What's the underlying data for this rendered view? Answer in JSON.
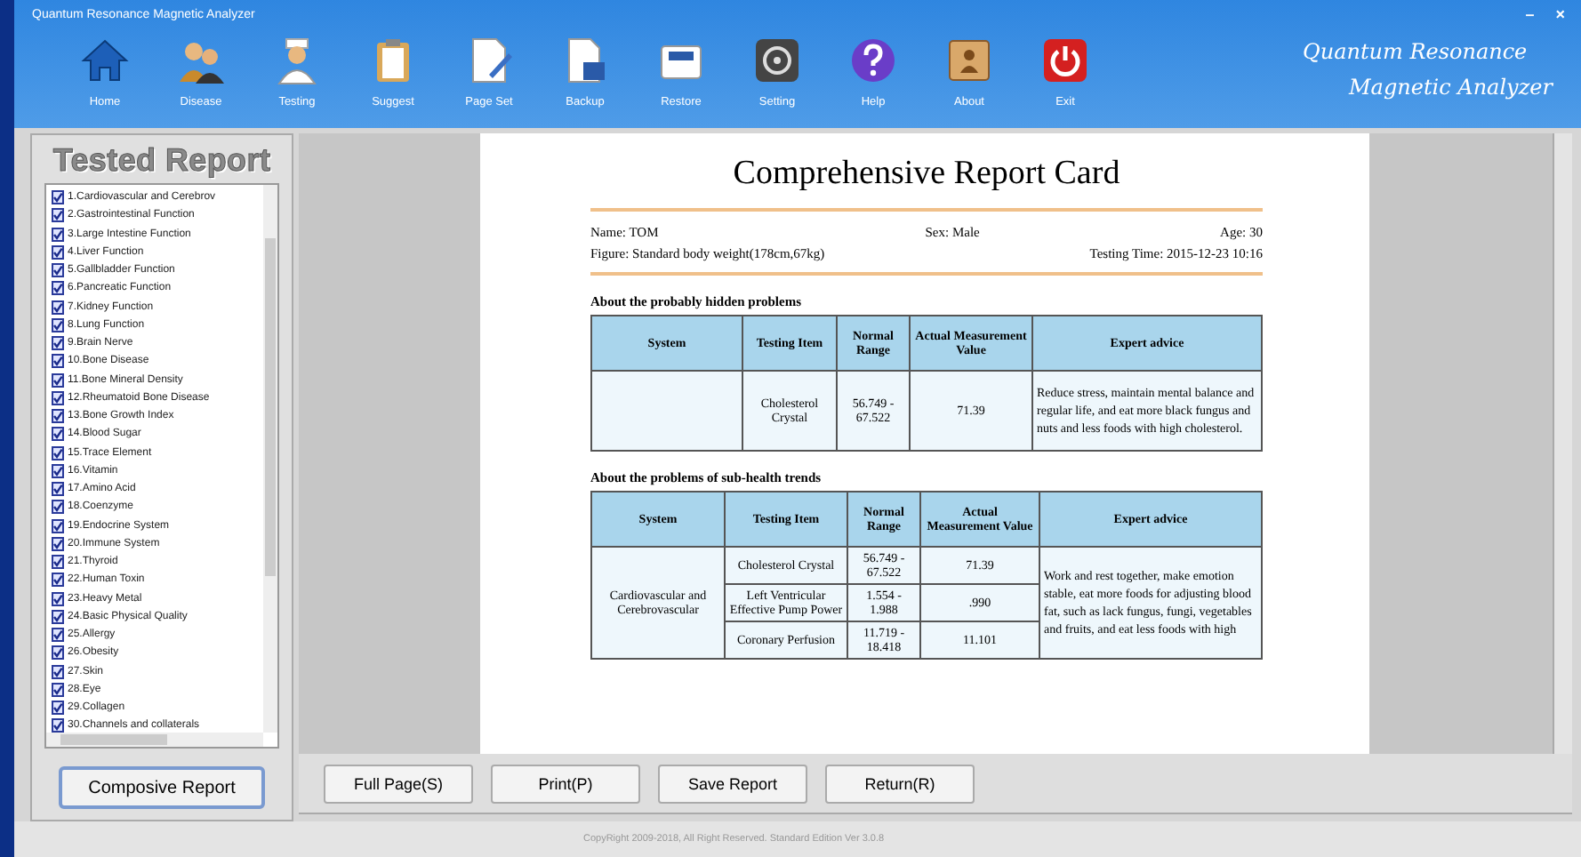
{
  "window": {
    "title": "Quantum Resonance Magnetic Analyzer",
    "controls": [
      "–",
      "×"
    ]
  },
  "toolbar": [
    {
      "label": "Home"
    },
    {
      "label": "Disease"
    },
    {
      "label": "Testing"
    },
    {
      "label": "Suggest"
    },
    {
      "label": "Page Set"
    },
    {
      "label": "Backup"
    },
    {
      "label": "Restore"
    },
    {
      "label": "Setting"
    },
    {
      "label": "Help"
    },
    {
      "label": "About"
    },
    {
      "label": "Exit"
    }
  ],
  "brand": [
    "Quantum Resonance",
    "Magnetic Analyzer"
  ],
  "sidebar": {
    "title": "Tested Report",
    "items": [
      {
        "label": "1.Cardiovascular and Cerebrov",
        "checked": true
      },
      {
        "label": "2.Gastrointestinal Function",
        "checked": true
      },
      {
        "label": "3.Large Intestine Function",
        "checked": true
      },
      {
        "label": "4.Liver Function",
        "checked": true
      },
      {
        "label": "5.Gallbladder Function",
        "checked": true
      },
      {
        "label": "6.Pancreatic Function",
        "checked": true
      },
      {
        "label": "7.Kidney Function",
        "checked": true
      },
      {
        "label": "8.Lung Function",
        "checked": true
      },
      {
        "label": "9.Brain Nerve",
        "checked": true
      },
      {
        "label": "10.Bone Disease",
        "checked": true
      },
      {
        "label": "11.Bone Mineral Density",
        "checked": true
      },
      {
        "label": "12.Rheumatoid Bone Disease",
        "checked": true
      },
      {
        "label": "13.Bone Growth Index",
        "checked": true
      },
      {
        "label": "14.Blood Sugar",
        "checked": true
      },
      {
        "label": "15.Trace Element",
        "checked": true
      },
      {
        "label": "16.Vitamin",
        "checked": true
      },
      {
        "label": "17.Amino Acid",
        "checked": true
      },
      {
        "label": "18.Coenzyme",
        "checked": true
      },
      {
        "label": "19.Endocrine System",
        "checked": true
      },
      {
        "label": "20.Immune System",
        "checked": true
      },
      {
        "label": "21.Thyroid",
        "checked": true
      },
      {
        "label": "22.Human Toxin",
        "checked": true
      },
      {
        "label": "23.Heavy Metal",
        "checked": true
      },
      {
        "label": "24.Basic Physical Quality",
        "checked": true
      },
      {
        "label": "25.Allergy",
        "checked": true
      },
      {
        "label": "26.Obesity",
        "checked": true
      },
      {
        "label": "27.Skin",
        "checked": true
      },
      {
        "label": "28.Eye",
        "checked": true
      },
      {
        "label": "29.Collagen",
        "checked": true
      },
      {
        "label": "30.Channels and collaterals",
        "checked": true
      }
    ],
    "button": "Composive Report"
  },
  "report": {
    "title": "Comprehensive Report Card",
    "name": "Name: TOM",
    "sex": "Sex: Male",
    "age": "Age: 30",
    "figure": "Figure: Standard body weight(178cm,67kg)",
    "testing_time": "Testing Time: 2015-12-23 10:16",
    "sections": [
      {
        "heading": "About the probably hidden problems",
        "columns": [
          "System",
          "Testing Item",
          "Normal Range",
          "Actual Measurement Value",
          "Expert advice"
        ],
        "groups": [
          {
            "advice": "Reduce stress, maintain mental balance and regular life, and eat more black fungus and nuts and less foods with high cholesterol.",
            "items": [
              {
                "item": "Cholesterol Crystal",
                "range": "56.749 - 67.522",
                "value": "71.39"
              }
            ]
          }
        ]
      },
      {
        "heading": "About the problems of sub-health trends",
        "columns": [
          "System",
          "Testing Item",
          "Normal Range",
          "Actual Measurement Value",
          "Expert advice"
        ],
        "groups": [
          {
            "system": "Cardiovascular and Cerebrovascular",
            "advice": "Work and rest together, make emotion stable, eat more foods for adjusting blood fat, such as lack fungus, fungi, vegetables and fruits, and eat less foods with high",
            "items": [
              {
                "item": "Cholesterol Crystal",
                "range": "56.749 - 67.522",
                "value": "71.39"
              },
              {
                "item": "Left Ventricular Effective Pump Power",
                "range": "1.554 - 1.988",
                "value": ".990"
              },
              {
                "item": "Coronary Perfusion",
                "range": "11.719 - 18.418",
                "value": "11.101"
              }
            ]
          }
        ]
      }
    ]
  },
  "actions": [
    "Full Page(S)",
    "Print(P)",
    "Save Report",
    "Return(R)"
  ],
  "status_bar": "CopyRight 2009-2018, All Right Reserved.  Standard Edition Ver 3.0.8"
}
